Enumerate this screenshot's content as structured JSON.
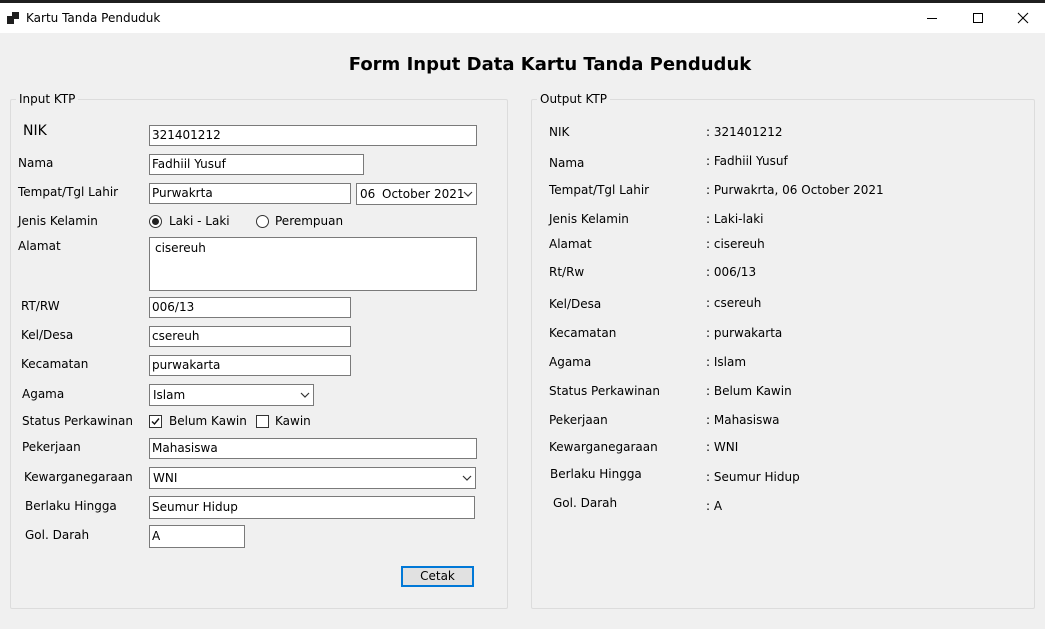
{
  "window": {
    "title": "Kartu Tanda Penduduk"
  },
  "form_title": "Form Input Data Kartu Tanda Penduduk",
  "input": {
    "legend": "Input KTP",
    "labels": {
      "nik": "NIK",
      "nama": "Nama",
      "ttl": "Tempat/Tgl Lahir",
      "jk": "Jenis Kelamin",
      "alamat": "Alamat",
      "rtrw": "RT/RW",
      "keldesa": "Kel/Desa",
      "kecamatan": "Kecamatan",
      "agama": "Agama",
      "status": "Status Perkawinan",
      "pekerjaan": "Pekerjaan",
      "kewarganegaraan": "Kewarganegaraan",
      "berlaku": "Berlaku Hingga",
      "goldarah": "Gol. Darah"
    },
    "values": {
      "nik": "321401212",
      "nama": "Fadhiil Yusuf",
      "tempat": "Purwakrta",
      "date_day": "06",
      "date_month": "October",
      "date_year": "2021",
      "alamat": "cisereuh",
      "rtrw": "006/13",
      "keldesa": "csereuh",
      "kecamatan": "purwakarta",
      "agama": "Islam",
      "pekerjaan": "Mahasiswa",
      "kewarganegaraan": "WNI",
      "berlaku": "Seumur Hidup",
      "goldarah": "A"
    },
    "gender": {
      "male": "Laki - Laki",
      "female": "Perempuan",
      "selected": "male"
    },
    "marital": {
      "belum": "Belum Kawin",
      "kawin": "Kawin",
      "belum_checked": true,
      "kawin_checked": false
    },
    "button": "Cetak"
  },
  "output": {
    "legend": "Output KTP",
    "rows": [
      {
        "label": "NIK",
        "value": ": 321401212"
      },
      {
        "label": "Nama",
        "value": ": Fadhiil Yusuf"
      },
      {
        "label": "Tempat/Tgl Lahir",
        "value": ": Purwakrta, 06 October 2021"
      },
      {
        "label": "Jenis Kelamin",
        "value": ": Laki-laki"
      },
      {
        "label": "Alamat",
        "value": ": cisereuh"
      },
      {
        "label": "Rt/Rw",
        "value": ": 006/13"
      },
      {
        "label": "Kel/Desa",
        "value": ": csereuh"
      },
      {
        "label": "Kecamatan",
        "value": ": purwakarta"
      },
      {
        "label": "Agama",
        "value": ": Islam"
      },
      {
        "label": "Status Perkawinan",
        "value": ": Belum Kawin"
      },
      {
        "label": "Pekerjaan",
        "value": ": Mahasiswa"
      },
      {
        "label": "Kewarganegaraan",
        "value": ": WNI"
      },
      {
        "label": "Berlaku Hingga",
        "value": ": Seumur Hidup"
      },
      {
        "label": "Gol. Darah",
        "value": ": A"
      }
    ]
  }
}
